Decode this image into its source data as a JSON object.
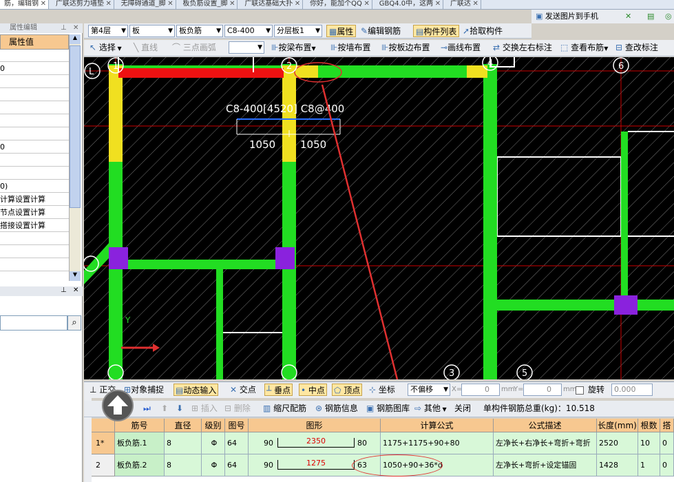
{
  "tabs": [
    "筋，编辑钢",
    "广联达剪力墙垫",
    "无障碍通道_脚",
    "板负筋设置_脚",
    "广联达基础大扑",
    "你好，能加个QQ",
    "GBQ4.0中，这两",
    "广联达"
  ],
  "send_to_phone": "发送图片到手机",
  "left_panel": {
    "title": "属性编辑",
    "header": "属性值",
    "rows": [
      "",
      "0",
      "",
      "",
      "",
      "",
      "",
      "0",
      "",
      "",
      "0)",
      "计算设置计算",
      "节点设置计算",
      "搭接设置计算",
      "",
      "",
      ""
    ],
    "search_placeholder": ""
  },
  "toolbar1": {
    "floor": "第4层",
    "component_type": "板",
    "sub_type": "板负筋",
    "spec": "C8-400",
    "layer": "分层板1",
    "btn_props": "属性",
    "btn_edit_rebar": "编辑钢筋",
    "btn_component_list": "构件列表",
    "btn_pick": "拾取构件"
  },
  "toolbar2": {
    "select": "选择",
    "line": "直线",
    "arc": "三点画弧",
    "by_beam": "按梁布置",
    "by_wall": "按墙布置",
    "by_slab_edge": "按板边布置",
    "draw_line": "画线布置",
    "swap_labels": "交换左右标注",
    "view_layout": "查看布筋",
    "edit_label": "查改标注"
  },
  "canvas": {
    "label_main": "C8-400[4520] C8@400",
    "dim_left": "1050",
    "dim_right": "1050",
    "axis_labels": [
      "L",
      "1",
      "2",
      "4",
      "6",
      "3",
      "5"
    ],
    "axis_y": "Y"
  },
  "snapbar": {
    "ortho": "正交",
    "obj_snap": "对象捕捉",
    "dyn_input": "动态输入",
    "intersect": "交点",
    "perp": "垂点",
    "mid": "中点",
    "vertex": "顶点",
    "coord": "坐标",
    "offset": "不偏移",
    "x_label": "X=",
    "x_val": "0",
    "y_label": "Y=",
    "y_val": "0",
    "unit": "mm",
    "rotate": "旋转",
    "rotate_val": "0.000"
  },
  "toolbar3": {
    "insert": "插入",
    "delete": "删除",
    "scale_rebar": "缩尺配筋",
    "rebar_info": "钢筋信息",
    "rebar_lib": "钢筋图库",
    "other": "其他",
    "close": "关闭",
    "total_weight": "单构件钢筋总重(kg)：10.518"
  },
  "table": {
    "headers": [
      "筋号",
      "直径(mm)",
      "级别",
      "图号",
      "图形",
      "计算公式",
      "公式描述",
      "长度(mm)",
      "根数",
      "搭"
    ],
    "rows": [
      {
        "idx": "1*",
        "name": "板负筋.1",
        "dia": "8",
        "grade": "Φ",
        "fig": "64",
        "s1": "90",
        "s2": "2350",
        "s3": "80",
        "formula": "1175+1175+90+80",
        "desc": "左净长+右净长+弯折+弯折",
        "len": "2520",
        "count": "10",
        "lap": "0"
      },
      {
        "idx": "2",
        "name": "板负筋.2",
        "dia": "8",
        "grade": "Φ",
        "fig": "64",
        "s1": "90",
        "s2": "1275",
        "s3": "63",
        "formula": "1050+90+36*d",
        "desc": "左净长+弯折+设定锚固",
        "len": "1428",
        "count": "1",
        "lap": "0"
      }
    ]
  }
}
